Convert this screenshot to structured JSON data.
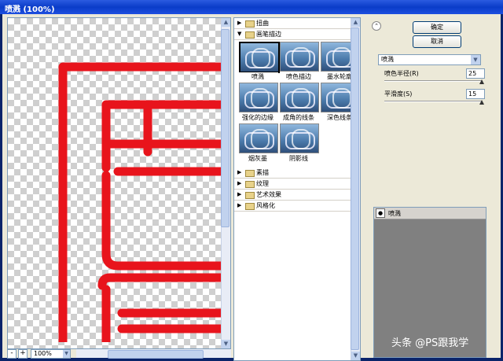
{
  "window": {
    "title": "喷溅 (100%)"
  },
  "preview": {
    "zoom": "100%",
    "zoom_out_label": "-",
    "zoom_in_label": "+",
    "seal_color": "#e8141c"
  },
  "gallery": {
    "categories_top": [
      {
        "label": "扭曲",
        "expanded": false
      }
    ],
    "open_category": {
      "label": "画笔描边",
      "expanded": true
    },
    "thumbnails": [
      {
        "label": "喷溅",
        "selected": true
      },
      {
        "label": "喷色描边",
        "selected": false
      },
      {
        "label": "墨水轮廓",
        "selected": false
      },
      {
        "label": "强化的边缘",
        "selected": false
      },
      {
        "label": "成角的线条",
        "selected": false
      },
      {
        "label": "深色线条",
        "selected": false
      },
      {
        "label": "烟灰墨",
        "selected": false
      },
      {
        "label": "阴影线",
        "selected": false
      }
    ],
    "categories_bottom": [
      {
        "label": "素描",
        "expanded": false
      },
      {
        "label": "纹理",
        "expanded": false
      },
      {
        "label": "艺术效果",
        "expanded": false
      },
      {
        "label": "风格化",
        "expanded": false
      }
    ]
  },
  "controls": {
    "ok_label": "确定",
    "cancel_label": "取消",
    "filter_selected": "喷溅",
    "params": [
      {
        "label": "喷色半径(R)",
        "value": "25",
        "fraction": 1.0
      },
      {
        "label": "平滑度(S)",
        "value": "15",
        "fraction": 1.0
      }
    ]
  },
  "layers": {
    "items": [
      {
        "name": "喷溅",
        "visible": true
      }
    ]
  },
  "watermark": "头条 @PS跟我学",
  "icons": {
    "collapse": "double-chevron-up-icon",
    "expanded": "triangle-down-icon",
    "collapsed": "triangle-right-icon",
    "folder": "folder-icon",
    "eye": "eye-icon"
  }
}
